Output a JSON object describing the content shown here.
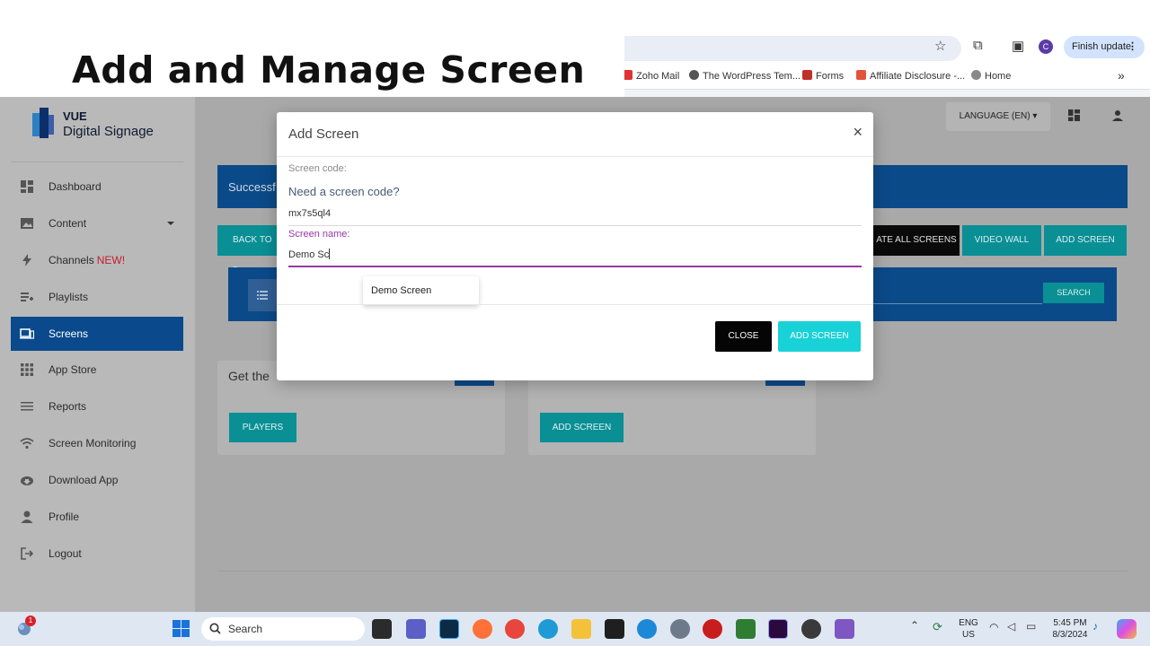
{
  "video_title": "Add and Manage Screen",
  "browser": {
    "finish_update_label": "Finish update",
    "profile_initial": "C",
    "bookmarks": [
      "Zoho Mail",
      "The WordPress Tem...",
      "Forms",
      "Affiliate Disclosure -...",
      "Home"
    ],
    "more_bookmarks": "»"
  },
  "app": {
    "logo_line1": "VUE",
    "logo_line2": "Digital Signage",
    "language_label": "LANGUAGE (EN)",
    "nav": [
      {
        "label": "Dashboard",
        "icon": "dashboard-icon"
      },
      {
        "label": "Content",
        "icon": "image-icon"
      },
      {
        "label": "Channels",
        "badge": "NEW!",
        "icon": "bolt-icon"
      },
      {
        "label": "Playlists",
        "icon": "playlist-icon"
      },
      {
        "label": "Screens",
        "icon": "devices-icon"
      },
      {
        "label": "App Store",
        "icon": "apps-grid-icon"
      },
      {
        "label": "Reports",
        "icon": "reports-icon"
      },
      {
        "label": "Screen Monitoring",
        "icon": "wifi-icon"
      },
      {
        "label": "Download App",
        "icon": "cloud-download-icon"
      },
      {
        "label": "Profile",
        "icon": "person-icon"
      },
      {
        "label": "Logout",
        "icon": "logout-icon"
      }
    ],
    "banner_text": "Successf",
    "buttons": {
      "back": "BACK TO D",
      "update_all": "ATE ALL SCREENS",
      "video_wall": "VIDEO WALL",
      "add_screen": "ADD SCREEN",
      "search": "SEARCH"
    },
    "card1": {
      "text": "Get the",
      "button": "PLAYERS"
    },
    "card2": {
      "button": "ADD SCREEN"
    }
  },
  "modal": {
    "title": "Add Screen",
    "close_symbol": "×",
    "code_label": "Screen code:",
    "code_link": "Need a screen code?",
    "code_value": "mx7s5ql4",
    "name_label": "Screen name:",
    "name_value": "Demo Sc",
    "suggestion": "Demo Screen",
    "close_button": "CLOSE",
    "add_button": "ADD SCREEN"
  },
  "taskbar": {
    "search_label": "Search",
    "notification_count": "1",
    "lang_line1": "ENG",
    "lang_line2": "US",
    "time": "5:45 PM",
    "date": "8/3/2024"
  }
}
